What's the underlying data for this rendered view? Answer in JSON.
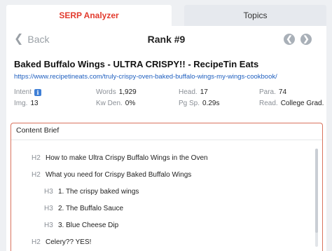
{
  "tabs": {
    "serp_analyzer": "SERP Analyzer",
    "topics": "Topics"
  },
  "header": {
    "back_label": "Back",
    "back_arrow": "❮",
    "rank_label": "Rank #9",
    "prev_glyph": "❮",
    "next_glyph": "❯"
  },
  "result": {
    "title": "Baked Buffalo Wings - ULTRA CRISPY!! - RecipeTin Eats",
    "url": "https://www.recipetineats.com/truly-crispy-oven-baked-buffalo-wings-my-wings-cookbook/"
  },
  "metrics": {
    "intent": {
      "label": "Intent",
      "info": "i"
    },
    "words": {
      "label": "Words",
      "value": "1,929"
    },
    "head": {
      "label": "Head.",
      "value": "17"
    },
    "para": {
      "label": "Para.",
      "value": "74"
    },
    "img": {
      "label": "Img.",
      "value": "13"
    },
    "kw_den": {
      "label": "Kw Den.",
      "value": "0%"
    },
    "pg_sp": {
      "label": "Pg Sp.",
      "value": "0.29s"
    },
    "read": {
      "label": "Read.",
      "value": "College Grad."
    }
  },
  "content_brief": {
    "title": "Content Brief",
    "outline": [
      {
        "tag": "H2",
        "text": "How to make Ultra Crispy Buffalo Wings in the Oven"
      },
      {
        "tag": "H2",
        "text": "What you need for Crispy Baked Buffalo Wings"
      },
      {
        "tag": "H3",
        "text": "1. The crispy baked wings"
      },
      {
        "tag": "H3",
        "text": "2. The Buffalo Sauce"
      },
      {
        "tag": "H3",
        "text": "3. Blue Cheese Dip"
      },
      {
        "tag": "H2",
        "text": "Celery?? YES!"
      }
    ]
  },
  "colors": {
    "active_tab_text": "#e23b2e",
    "link": "#1f5fbf",
    "brief_border": "#d9735e",
    "info_icon": "#3f7fd6"
  }
}
